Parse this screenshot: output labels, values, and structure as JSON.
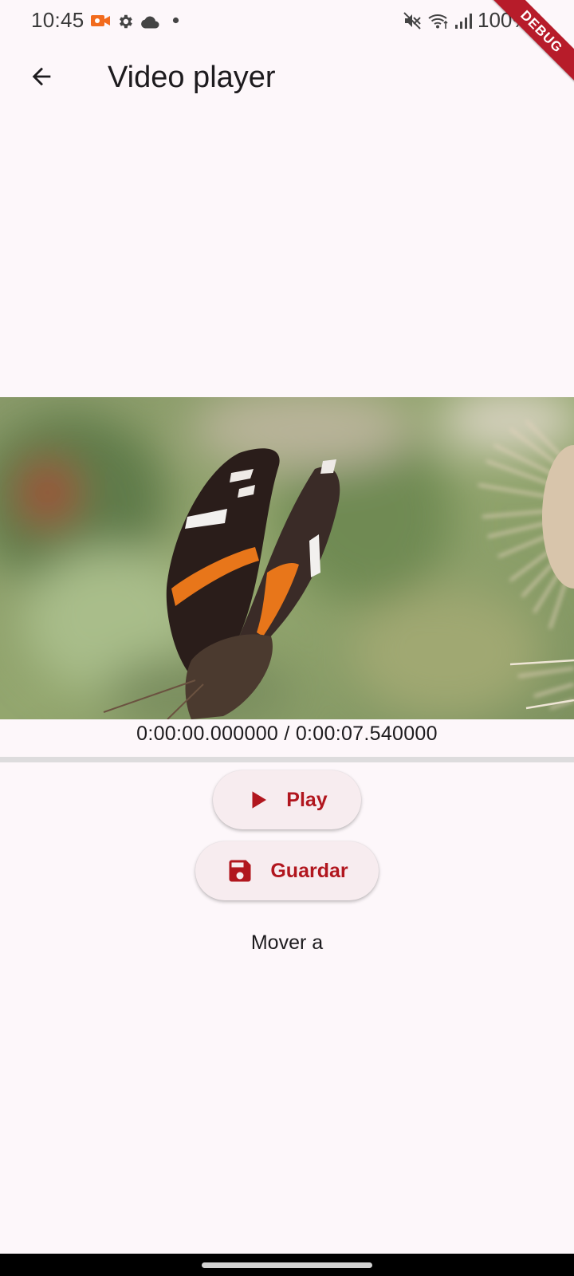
{
  "status_bar": {
    "time": "10:45",
    "battery": "100%",
    "icons": [
      "video-camera-icon",
      "gear-icon",
      "cloud-icon",
      "dot-icon",
      "mute-icon",
      "wifi-icon",
      "signal-icon",
      "battery-icon"
    ],
    "camera_color": "#f26b1d"
  },
  "debug_banner": {
    "label": "DEBUG",
    "color": "#b71c2a"
  },
  "app_bar": {
    "title": "Video player",
    "back_icon": "arrow-back-icon"
  },
  "player": {
    "position": "0:00:00.000000",
    "duration": "0:00:07.540000",
    "time_text": "0:00:00.000000 / 0:00:07.540000",
    "progress_fraction": 0.0
  },
  "buttons": {
    "play_label": "Play",
    "play_icon": "play-icon",
    "save_label": "Guardar",
    "save_icon": "save-icon"
  },
  "move_to_label": "Mover a",
  "colors": {
    "accent": "#b1161e",
    "background": "#fdf7fa",
    "button_bg": "#f7ecef"
  }
}
